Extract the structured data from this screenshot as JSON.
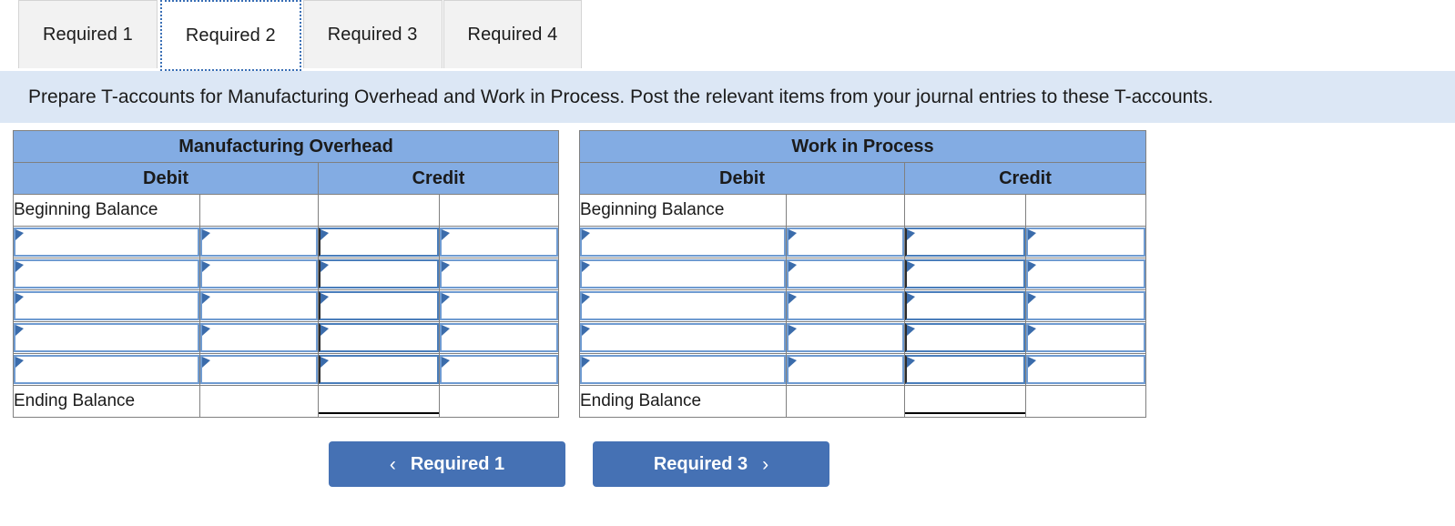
{
  "tabs": [
    {
      "label": "Required 1",
      "active": false
    },
    {
      "label": "Required 2",
      "active": true
    },
    {
      "label": "Required 3",
      "active": false
    },
    {
      "label": "Required 4",
      "active": false
    }
  ],
  "instruction": {
    "text": "Prepare T-accounts for Manufacturing Overhead and Work in Process. Post the relevant items from your journal entries to these T-accounts."
  },
  "taccounts": [
    {
      "title": "Manufacturing Overhead",
      "debit_header": "Debit",
      "credit_header": "Credit",
      "beginning_label": "Beginning Balance",
      "beginning_values": [
        "",
        "",
        "",
        ""
      ],
      "entry_rows": [
        {
          "debit_label": "",
          "debit_value": "",
          "credit_label": "",
          "credit_value": ""
        },
        {
          "debit_label": "",
          "debit_value": "",
          "credit_label": "",
          "credit_value": ""
        },
        {
          "debit_label": "",
          "debit_value": "",
          "credit_label": "",
          "credit_value": ""
        },
        {
          "debit_label": "",
          "debit_value": "",
          "credit_label": "",
          "credit_value": ""
        },
        {
          "debit_label": "",
          "debit_value": "",
          "credit_label": "",
          "credit_value": ""
        }
      ],
      "ending_label": "Ending Balance",
      "ending_values": [
        "",
        "",
        "",
        ""
      ]
    },
    {
      "title": "Work in Process",
      "debit_header": "Debit",
      "credit_header": "Credit",
      "beginning_label": "Beginning Balance",
      "beginning_values": [
        "",
        "",
        "",
        ""
      ],
      "entry_rows": [
        {
          "debit_label": "",
          "debit_value": "",
          "credit_label": "",
          "credit_value": ""
        },
        {
          "debit_label": "",
          "debit_value": "",
          "credit_label": "",
          "credit_value": ""
        },
        {
          "debit_label": "",
          "debit_value": "",
          "credit_label": "",
          "credit_value": ""
        },
        {
          "debit_label": "",
          "debit_value": "",
          "credit_label": "",
          "credit_value": ""
        },
        {
          "debit_label": "",
          "debit_value": "",
          "credit_label": "",
          "credit_value": ""
        }
      ],
      "ending_label": "Ending Balance",
      "ending_values": [
        "",
        "",
        "",
        ""
      ]
    }
  ],
  "nav": {
    "prev_label": "Required 1",
    "prev_icon": "chevron-left-icon",
    "prev_glyph": "‹",
    "next_label": "Required 3",
    "next_icon": "chevron-right-icon",
    "next_glyph": "›"
  },
  "colors": {
    "header_blue": "#83ace3",
    "button_blue": "#4571b4",
    "instruction_bg": "#dce7f5",
    "input_border": "#6f9bd1",
    "flag_blue": "#3b6cab",
    "tab_inactive_bg": "#f2f2f2",
    "focus_outline": "#3a6fb5"
  }
}
